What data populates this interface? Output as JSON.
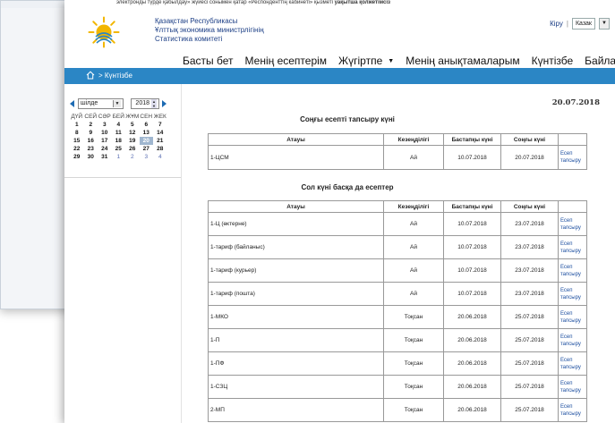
{
  "notice": {
    "text": "электронды түрде қабылдау» жүйесі сонымен қатар «Респонденттің кабинеті» қызметі",
    "bold": "уақытша қолжетімсіз"
  },
  "org": {
    "line1": "Қазақстан Республикасы",
    "line2": "Ұлттық экономика министрлігінің",
    "line3": "Статистика комитеті"
  },
  "top": {
    "login": "Кіру",
    "lang": "Казак"
  },
  "nav": {
    "items": [
      "Басты бет",
      "Менің есептерім",
      "Жүгіртпе",
      "Менің анықтамаларым",
      "Күнтізбе",
      "Байланыс ақпарат"
    ]
  },
  "breadcrumb": {
    "text": "> Күнтізбе"
  },
  "calendar": {
    "month": "шілде",
    "year": "2018",
    "weekdays": [
      "ДҮЙ",
      "СЕЙ",
      "СӘР",
      "БЕЙ",
      "ЖҰМ",
      "СЕН",
      "ЖЕК"
    ],
    "weeks": [
      [
        "1",
        "2",
        "3",
        "4",
        "5",
        "6",
        "7"
      ],
      [
        "8",
        "9",
        "10",
        "11",
        "12",
        "13",
        "14"
      ],
      [
        "15",
        "16",
        "17",
        "18",
        "19",
        "20",
        "21"
      ],
      [
        "22",
        "23",
        "24",
        "25",
        "26",
        "27",
        "28"
      ],
      [
        "29",
        "30",
        "31",
        "1",
        "2",
        "3",
        "4"
      ]
    ]
  },
  "date": "20.07.2018",
  "section1": {
    "title": "Соңғы есепті тапсыру күні",
    "headers": [
      "Атауы",
      "Кезеңділігі",
      "Бастапқы күні",
      "Соңғы күні"
    ],
    "rows": [
      {
        "name": "1-ЦСМ",
        "period": "Ай",
        "start": "10.07.2018",
        "end": "20.07.2018",
        "link": "Есеп тапсыру"
      }
    ]
  },
  "section2": {
    "title": "Сол күні басқа да есептер",
    "headers": [
      "Атауы",
      "Кезеңділігі",
      "Бастапқы күні",
      "Соңғы күні"
    ],
    "rows": [
      {
        "name": "1-Ц (өктерне)",
        "period": "Ай",
        "start": "10.07.2018",
        "end": "23.07.2018",
        "link": "Есеп тапсыру"
      },
      {
        "name": "1-тариф (байланыс)",
        "period": "Ай",
        "start": "10.07.2018",
        "end": "23.07.2018",
        "link": "Есеп тапсыру"
      },
      {
        "name": "1-тариф (курьер)",
        "period": "Ай",
        "start": "10.07.2018",
        "end": "23.07.2018",
        "link": "Есеп тапсыру"
      },
      {
        "name": "1-тариф (пошта)",
        "period": "Ай",
        "start": "10.07.2018",
        "end": "23.07.2018",
        "link": "Есеп тапсыру"
      },
      {
        "name": "1-МКО",
        "period": "Тоқсан",
        "start": "20.06.2018",
        "end": "25.07.2018",
        "link": "Есеп тапсыру"
      },
      {
        "name": "1-П",
        "period": "Тоқсан",
        "start": "20.06.2018",
        "end": "25.07.2018",
        "link": "Есеп тапсыру"
      },
      {
        "name": "1-ПФ",
        "period": "Тоқсан",
        "start": "20.06.2018",
        "end": "25.07.2018",
        "link": "Есеп тапсыру"
      },
      {
        "name": "1-СЗЦ",
        "period": "Тоқсан",
        "start": "20.06.2018",
        "end": "25.07.2018",
        "link": "Есеп тапсыру"
      },
      {
        "name": "2-МП",
        "period": "Тоқсан",
        "start": "20.06.2018",
        "end": "25.07.2018",
        "link": "Есеп тапсыру"
      }
    ]
  }
}
